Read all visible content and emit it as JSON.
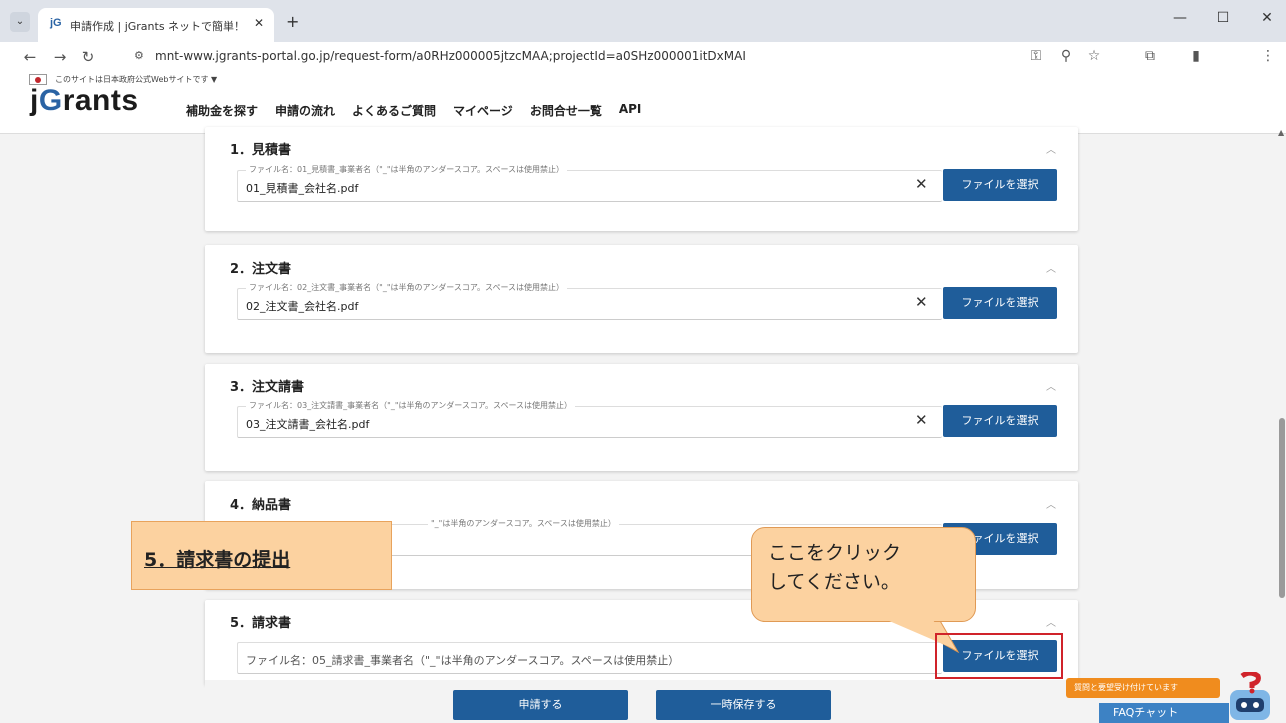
{
  "browser": {
    "tab_favicon": "jG",
    "tab_title": "申請作成 | jGrants ネットで簡単！",
    "url": "mnt-www.jgrants-portal.go.jp/request-form/a0RHz000005jtzcMAA;projectId=a0SHz000001itDxMAI"
  },
  "site": {
    "gov_notice": "このサイトは日本政府公式Webサイトです ▼",
    "logo_j": "j",
    "logo_g": "G",
    "logo_rest": "rants",
    "menu": [
      "補助金を探す",
      "申請の流れ",
      "よくあるご質問",
      "マイページ",
      "お問合せ一覧",
      "API"
    ]
  },
  "cards": [
    {
      "title": "1．見積書",
      "label": "ファイル名：01_見積書_事業者名（\"_\"は半角のアンダースコア。スペースは使用禁止）",
      "value": "01_見積書_会社名.pdf"
    },
    {
      "title": "2．注文書",
      "label": "ファイル名：02_注文書_事業者名（\"_\"は半角のアンダースコア。スペースは使用禁止）",
      "value": "02_注文書_会社名.pdf"
    },
    {
      "title": "3．注文請書",
      "label": "ファイル名：03_注文請書_事業者名（\"_\"は半角のアンダースコア。スペースは使用禁止）",
      "value": "03_注文請書_会社名.pdf"
    },
    {
      "title": "4．納品書",
      "label": "\"_\"は半角のアンダースコア。スペースは使用禁止）",
      "value": ""
    },
    {
      "title": "5．請求書",
      "placeholder": "ファイル名：05_請求書_事業者名（\"_\"は半角のアンダースコア。スペースは使用禁止）"
    }
  ],
  "file_button_label": "ファイルを選択",
  "file_button_label_partial": "ァイルを選択",
  "actions": {
    "submit": "申請する",
    "save": "一時保存する"
  },
  "annotations": {
    "section_label": "5．請求書の提出",
    "bubble": "ここをクリック\nしてください。"
  },
  "chat": {
    "notice": "質問と要望受け付けています",
    "faq": "FAQチャット"
  },
  "colors": {
    "primary": "#1f5d9a",
    "annotation": "#fcd2a0",
    "highlight": "#d0232a",
    "chat": "#f08c1e"
  }
}
